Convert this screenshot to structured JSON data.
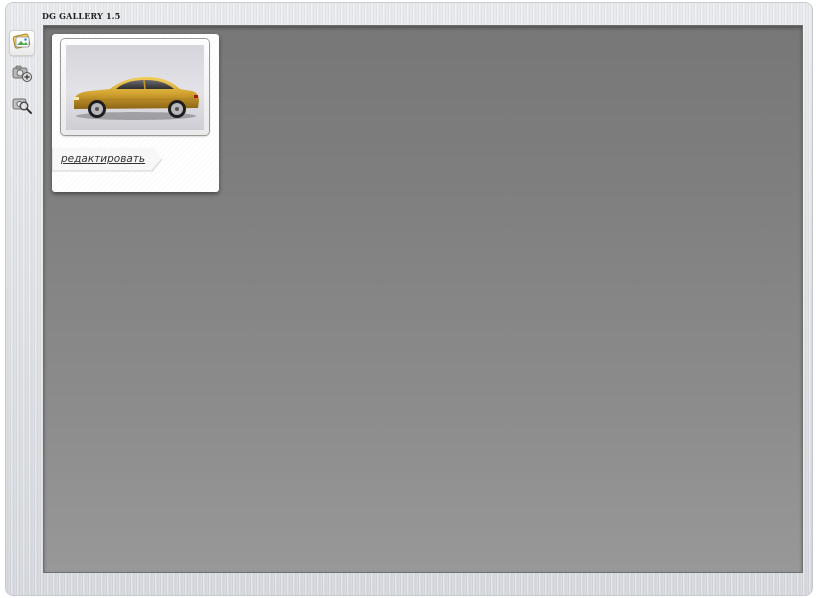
{
  "app": {
    "title": "DG GALLERY 1.5"
  },
  "toolbar": {
    "items": [
      {
        "icon": "gallery-image-icon",
        "active": true
      },
      {
        "icon": "add-camera-icon",
        "active": false
      },
      {
        "icon": "search-camera-icon",
        "active": false
      }
    ]
  },
  "gallery": {
    "items": [
      {
        "thumbnail": "gold-sports-car-photo",
        "edit_label": "редактировать"
      }
    ]
  },
  "colors": {
    "workspace": "#808080",
    "frame": "#dfe2e6",
    "car_body": "#d4a531"
  }
}
